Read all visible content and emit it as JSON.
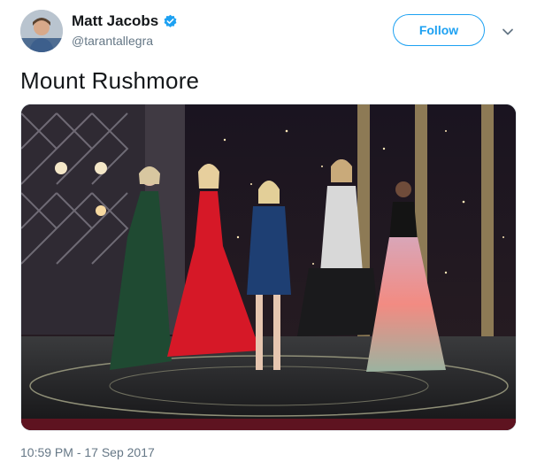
{
  "author": {
    "display_name": "Matt Jacobs",
    "handle": "@tarantallegra",
    "verified": true,
    "avatar_icon": "avatar-photo"
  },
  "follow_label": "Follow",
  "tweet": {
    "text": "Mount Rushmore",
    "image_icon": "photo-five-women-on-stage",
    "timestamp": "10:59 PM - 17 Sep 2017"
  },
  "colors": {
    "brand_blue": "#1da1f2",
    "secondary_text": "#657786"
  }
}
